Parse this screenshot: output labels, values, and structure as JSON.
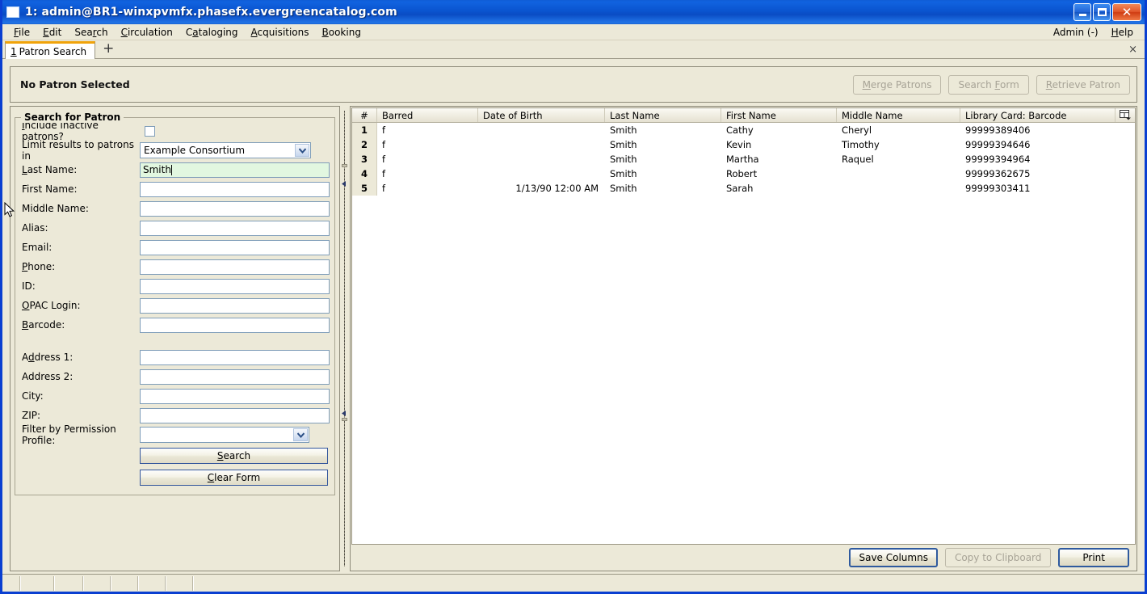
{
  "window": {
    "title": "1: admin@BR1-winxpvmfx.phasefx.evergreencatalog.com",
    "minimize_label": "Minimize",
    "maximize_label": "Maximize",
    "close_label": "Close"
  },
  "menubar": {
    "items": [
      {
        "label": "File",
        "accel": "F"
      },
      {
        "label": "Edit",
        "accel": "E"
      },
      {
        "label": "Search",
        "accel": "r"
      },
      {
        "label": "Circulation",
        "accel": "C"
      },
      {
        "label": "Cataloging",
        "accel": "a"
      },
      {
        "label": "Acquisitions",
        "accel": "A"
      },
      {
        "label": "Booking",
        "accel": "B"
      }
    ],
    "admin_label": "Admin (-)",
    "help_label": "Help"
  },
  "tabs": {
    "items": [
      {
        "index": "1",
        "label": "Patron Search"
      }
    ],
    "new_tab_label": "+",
    "close_label": "×"
  },
  "patron_bar": {
    "title": "No Patron Selected",
    "buttons": [
      {
        "label": "Merge Patrons",
        "disabled": true
      },
      {
        "label": "Search Form",
        "disabled": true
      },
      {
        "label": "Retrieve Patron",
        "disabled": true
      }
    ]
  },
  "search_form": {
    "legend": "Search for Patron",
    "include_inactive_label": "Include inactive patrons?",
    "include_inactive_checked": false,
    "limit_results_label": "Limit results to patrons in",
    "limit_results_value": "Example Consortium",
    "fields": [
      {
        "label": "Last Name:",
        "value": "Smith",
        "focused": true
      },
      {
        "label": "First Name:",
        "value": "",
        "focused": false
      },
      {
        "label": "Middle Name:",
        "value": "",
        "focused": false
      },
      {
        "label": "Alias:",
        "value": "",
        "focused": false
      },
      {
        "label": "Email:",
        "value": "",
        "focused": false
      },
      {
        "label": "Phone:",
        "value": "",
        "focused": false
      },
      {
        "label": "ID:",
        "value": "",
        "focused": false
      },
      {
        "label": "OPAC Login:",
        "value": "",
        "focused": false
      },
      {
        "label": "Barcode:",
        "value": "",
        "focused": false
      }
    ],
    "address_fields": [
      {
        "label": "Address 1:",
        "value": ""
      },
      {
        "label": "Address 2:",
        "value": ""
      },
      {
        "label": "City:",
        "value": ""
      },
      {
        "label": "ZIP:",
        "value": ""
      }
    ],
    "permission_profile_label": "Filter by Permission Profile:",
    "permission_profile_value": "",
    "search_button": "Search",
    "clear_button": "Clear Form"
  },
  "results": {
    "columns": [
      "#",
      "Barred",
      "Date of Birth",
      "Last Name",
      "First Name",
      "Middle Name",
      "Library Card: Barcode"
    ],
    "column_picker_icon": "column-picker-icon",
    "rows": [
      {
        "num": "1",
        "barred": "f",
        "dob": "",
        "last": "Smith",
        "first": "Cathy",
        "middle": "Cheryl",
        "card": "99999389406"
      },
      {
        "num": "2",
        "barred": "f",
        "dob": "",
        "last": "Smith",
        "first": "Kevin",
        "middle": "Timothy",
        "card": "99999394646"
      },
      {
        "num": "3",
        "barred": "f",
        "dob": "",
        "last": "Smith",
        "first": "Martha",
        "middle": "Raquel",
        "card": "99999394964"
      },
      {
        "num": "4",
        "barred": "f",
        "dob": "",
        "last": "Smith",
        "first": "Robert",
        "middle": "",
        "card": "99999362675"
      },
      {
        "num": "5",
        "barred": "f",
        "dob": "1/13/90 12:00 AM",
        "last": "Smith",
        "first": "Sarah",
        "middle": "",
        "card": "99999303411"
      }
    ],
    "footer_buttons": [
      {
        "label": "Save Columns",
        "disabled": false,
        "default": true
      },
      {
        "label": "Copy to Clipboard",
        "disabled": true,
        "default": false
      },
      {
        "label": "Print",
        "disabled": false,
        "default": true
      }
    ]
  },
  "colors": {
    "titlebar_blue": "#0a54cf",
    "window_face": "#ece9d8",
    "tab_accent": "#f0a30a",
    "focused_field": "#e2f7e0",
    "field_border": "#7f9db9"
  }
}
